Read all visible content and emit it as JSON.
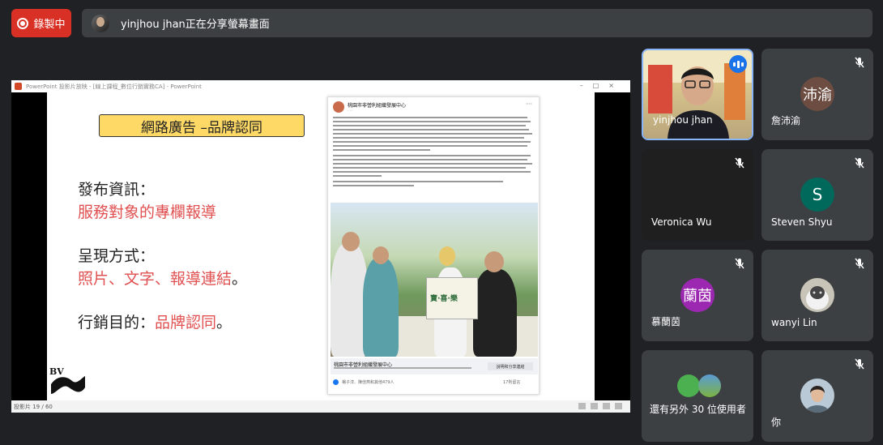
{
  "top_bar": {
    "recording_label": "錄製中",
    "share_text": "yinjhou jhan正在分享螢幕畫面"
  },
  "ppt": {
    "window_title": "PowerPoint 投影片放映 - [線上課程_數位行銷實務CA] - PowerPoint",
    "status": "投影片 19 / 60"
  },
  "slide": {
    "heading": "網路廣告 –品牌認同",
    "line1": "發布資訊：",
    "line2": "服務對象的專欄報導",
    "line3": "呈現方式：",
    "line4_red": "照片、文字、報導連結",
    "line4_tail": "。",
    "line5": "行銷目的：",
    "line5_red": "品牌認同",
    "line5_tail": "。",
    "logo_text": "BV"
  },
  "fb_post": {
    "page_name": "桃園市非營利組織發展中心",
    "link_title": "桃園市非營利組織發展中心",
    "link_button": "說明和分享連結",
    "banner_text": "寶·喜·樂",
    "reactions": "楊子淳、陳佳燕和其他479人",
    "comments": "17則留言"
  },
  "participants": [
    {
      "name": "yinjhou jhan",
      "type": "video"
    },
    {
      "name": "詹沛渝",
      "initials": "沛渝",
      "color": "#6d4c41",
      "muted": true
    },
    {
      "name": "Veronica Wu",
      "muted": true
    },
    {
      "name": "Steven Shyu",
      "initials": "S",
      "color": "#00695c",
      "muted": true
    },
    {
      "name": "慕蘭茵",
      "initials": "蘭茵",
      "color": "#9c27b0",
      "muted": true
    },
    {
      "name": "wanyi Lin",
      "muted": true
    },
    {
      "name": "還有另外 30 位使用者"
    },
    {
      "name": "你",
      "muted": true
    }
  ],
  "colors": {
    "background": "#202124",
    "tile": "#3c4043",
    "recording": "#d93025",
    "accent": "#8ab4f8",
    "slide_red": "#e05050",
    "heading_fill": "#ffd966"
  },
  "icons": [
    "record-icon",
    "mic-off-icon",
    "audio-active-icon"
  ]
}
